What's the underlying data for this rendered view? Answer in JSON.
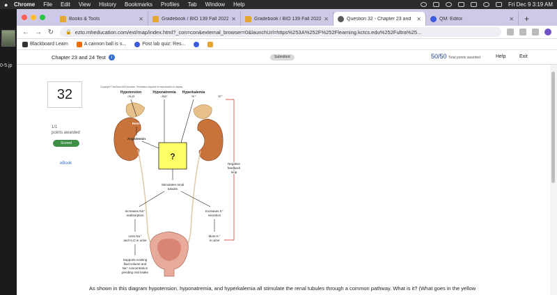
{
  "menubar": {
    "app": "Chrome",
    "items": [
      "File",
      "Edit",
      "View",
      "History",
      "Bookmarks",
      "Profiles",
      "Tab",
      "Window",
      "Help"
    ],
    "clock": "Fri Dec 9  3:19 AM"
  },
  "desktop": {
    "file_label": "0-5.jp"
  },
  "tabs": [
    {
      "title": "Books & Tools"
    },
    {
      "title": "Gradebook / BIO 139 Fall 2022"
    },
    {
      "title": "Gradebook / BIO 139 Fall 2022"
    },
    {
      "title": "Question 32 - Chapter 23 and"
    },
    {
      "title": "QM: Editor"
    }
  ],
  "address_bar": {
    "url": "ezto.mheducation.com/ext/map/index.html?_con=con&external_browser=0&launchUrl=https%253A%252F%252Flearning.kctcs.edu%252Fultra%25..."
  },
  "bookmarks": [
    "Blackboard Learn",
    "A cannon ball is s...",
    "Post lab quiz: Res...",
    ""
  ],
  "header": {
    "title": "Chapter 23 and 24 Test",
    "submitted": "Submitted",
    "score": "50/50",
    "score_note": "Total points awarded",
    "help": "Help",
    "exit": "Exit"
  },
  "question": {
    "number": "32",
    "points_value": "1/1",
    "points_label": "points awarded",
    "scored": "Scored",
    "ebook": "eBook",
    "text": "As shown in this diagram hypotension, hyponatremia, and hyperkalemia all stimulate the renal tubules through a common pathway. What is it? (What goes in the yellow"
  },
  "diagram": {
    "copyright": "Copyright © McGraw-Hill Education. Permission required for reproduction or display.",
    "stim1": "Hypotension",
    "stim1_sub": "↓H₂O",
    "stim2": "Hyponatremia",
    "stim2_sub": "↓Na⁺",
    "stim3": "Hyperkalemia",
    "stim3_sub": "↑K⁺",
    "stim4": "↑K⁺",
    "renin": "Renin",
    "angiotensin": "Angiotensin",
    "unknown": "?",
    "stimulates1": "Stimulates renal",
    "stimulates2": "tubules",
    "inc_na1": "Increases Na⁺",
    "inc_na2": "reabsorption",
    "inc_k1": "Increases K⁺",
    "inc_k2": "secretion",
    "less_na1": "Less Na⁺",
    "less_na2": "and H₂O in urine",
    "more_k1": "More K⁺",
    "more_k2": "in urine",
    "support1": "Supports existing",
    "support2": "fluid volume and",
    "support3": "Na⁺ concentration",
    "support4": "pending oral intake",
    "feedback1": "Negative",
    "feedback2": "feedback",
    "feedback3": "loop"
  },
  "colors": {
    "unknown_box": "#ffff66",
    "feedback_line": "#cc2222",
    "kidney": "#c8733c",
    "adrenal": "#e8c08a",
    "bladder": "#e8aa9a"
  }
}
